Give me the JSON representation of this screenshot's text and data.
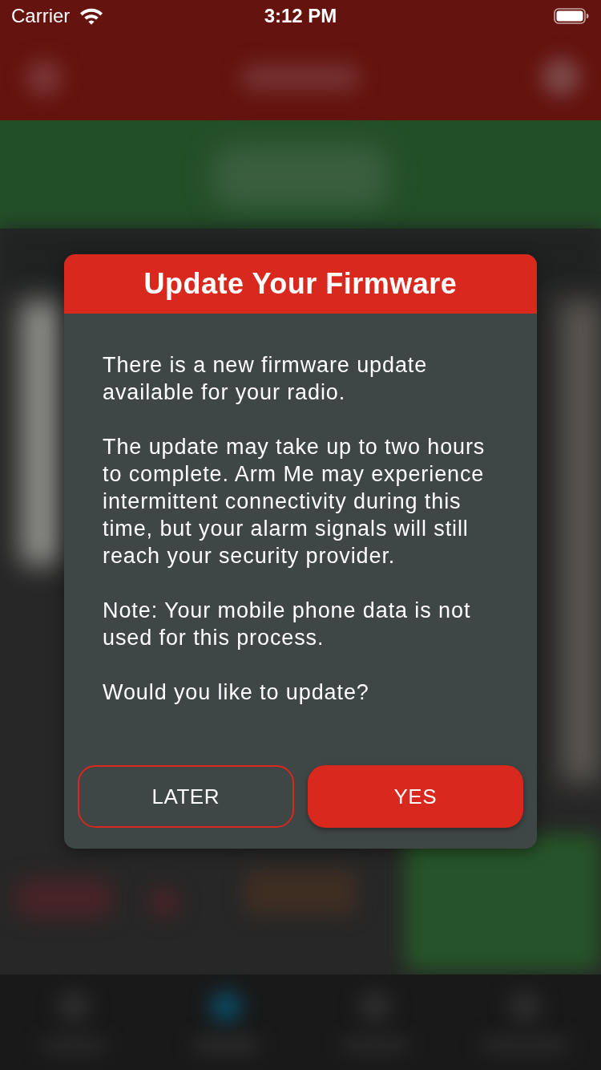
{
  "status_bar": {
    "carrier": "Carrier",
    "time": "3:12 PM"
  },
  "dialog": {
    "title": "Update Your Firmware",
    "paragraphs": [
      "There is a new firmware update available for your radio.",
      "The update may take up to two hours to complete. Arm Me may experience intermittent connectivity during this time, but your alarm signals will still reach your security provider.",
      "Note: Your mobile phone data is not used for this process.",
      "Would you like to update?"
    ],
    "buttons": [
      {
        "label": "LATER",
        "kind": "outline"
      },
      {
        "label": "YES",
        "kind": "filled"
      }
    ]
  }
}
